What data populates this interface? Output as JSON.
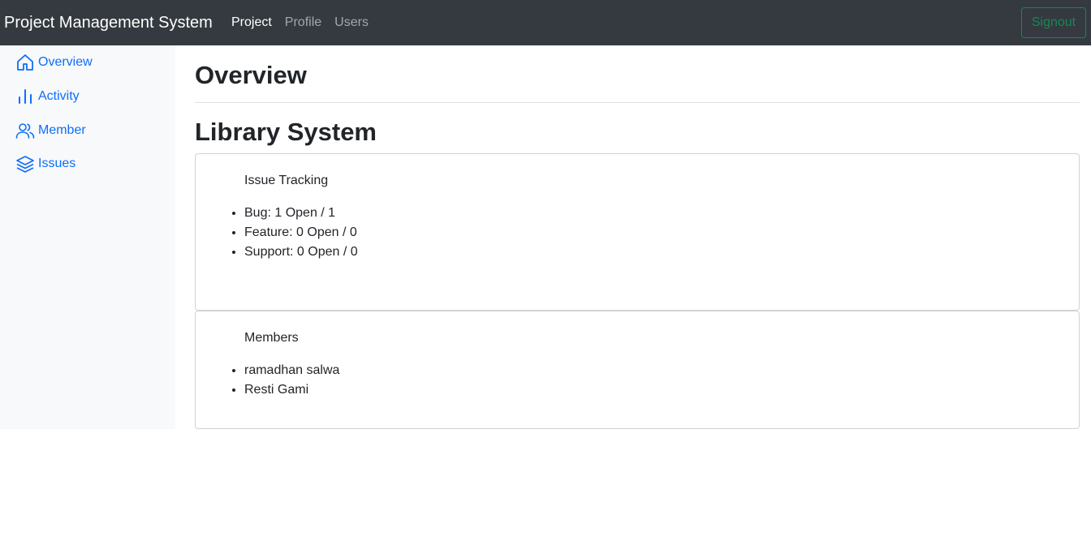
{
  "navbar": {
    "brand": "Project Management System",
    "links": [
      {
        "label": "Project",
        "active": true
      },
      {
        "label": "Profile",
        "active": false
      },
      {
        "label": "Users",
        "active": false
      }
    ],
    "signout_label": "Signout"
  },
  "sidebar": {
    "items": [
      {
        "label": "Overview",
        "icon": "house-icon"
      },
      {
        "label": "Activity",
        "icon": "bar-chart-icon"
      },
      {
        "label": "Member",
        "icon": "people-icon"
      },
      {
        "label": "Issues",
        "icon": "layers-icon"
      }
    ]
  },
  "main": {
    "heading": "Overview",
    "project_name": "Library System",
    "issue_tracking": {
      "title": "Issue Tracking",
      "items": [
        "Bug: 1 Open / 1",
        "Feature: 0 Open / 0",
        "Support: 0 Open / 0"
      ]
    },
    "members": {
      "title": "Members",
      "items": [
        "ramadhan salwa",
        "Resti Gami"
      ]
    }
  },
  "colors": {
    "navbar_bg": "#343a40",
    "link_blue": "#0d6efd",
    "signout_green": "#198754",
    "sidebar_bg": "#f8f9fa"
  }
}
